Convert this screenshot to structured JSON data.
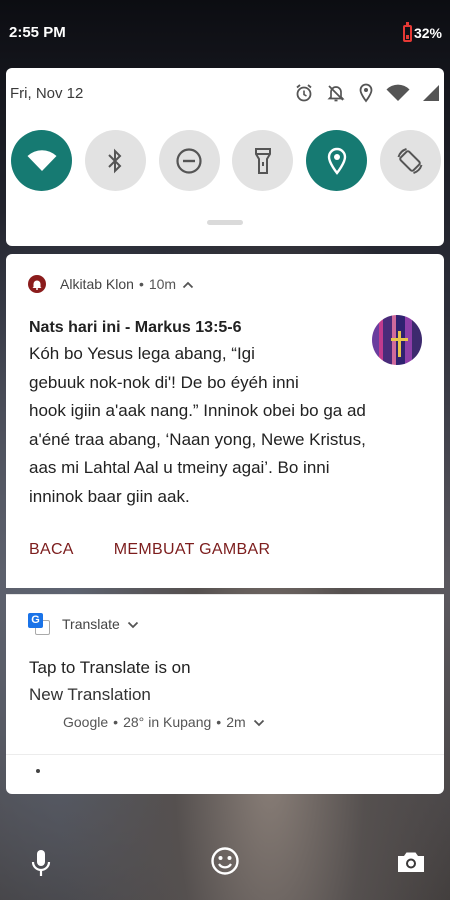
{
  "status_bar": {
    "time": "2:55 PM",
    "battery_percent": "32%",
    "battery_level": 0.32
  },
  "quick_settings": {
    "date": "Fri, Nov 12",
    "status_icons": [
      "alarm-icon",
      "mute-icon",
      "location-icon",
      "wifi-icon",
      "signal-icon"
    ],
    "tiles": [
      {
        "name": "wifi",
        "on": true
      },
      {
        "name": "bluetooth",
        "on": false
      },
      {
        "name": "do-not-disturb",
        "on": false
      },
      {
        "name": "flashlight",
        "on": false
      },
      {
        "name": "location",
        "on": true
      },
      {
        "name": "auto-rotate",
        "on": false
      }
    ],
    "accent_color": "#167a72"
  },
  "notification_alkitab": {
    "app_name": "Alkitab Klon",
    "age": "10m",
    "title": "Nats hari ini - Markus 13:5-6",
    "body": "Kóh bo Yesus lega abang, “Igi\ngebuuk nok-nok di'! De bo éyéh inni\nhook igiin a'aak nang.” Inninok obei bo ga ad\na'éné traa abang, ‘Naan yong, Newe Kristus,\naas mi Lahtal Aal u tmeiny agai’. Bo inni\ninninok baar giin aak.",
    "actions": [
      "BACA",
      "MEMBUAT GAMBAR"
    ],
    "action_color": "#7c1d1d"
  },
  "notification_translate": {
    "app_name": "Translate",
    "title": "Tap to Translate is on",
    "subtitle": "New Translation"
  },
  "notification_google": {
    "app_name": "Google",
    "temperature": "28°",
    "location": "in Kupang",
    "age": "2m"
  },
  "dock": {
    "icons": [
      "microphone-icon",
      "smiley-icon",
      "camera-icon"
    ]
  }
}
